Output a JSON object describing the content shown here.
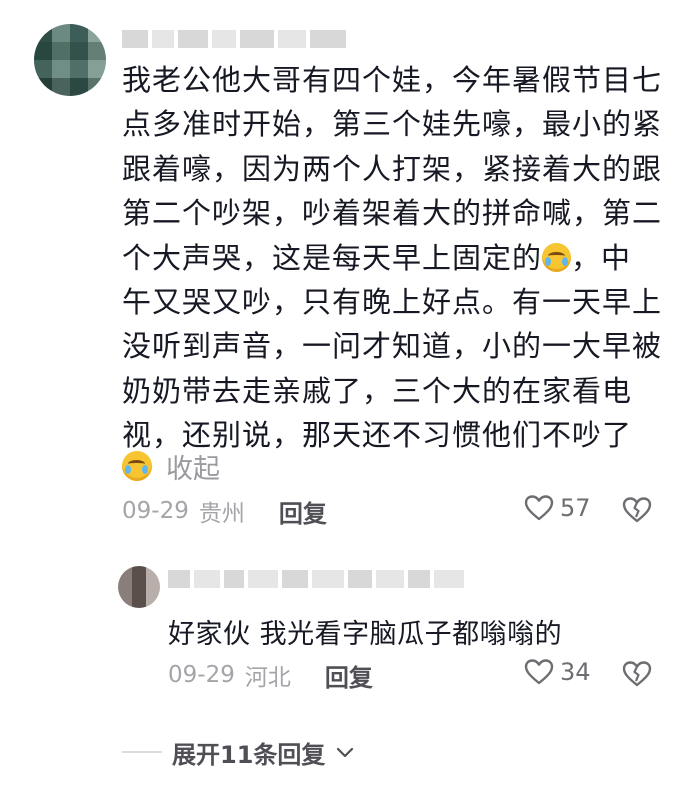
{
  "comment": {
    "lines": [
      "我老公他大哥有四个娃，今年暑假节目七",
      "点多准时开始，第三个娃先嚎，最小的紧",
      "跟着嚎，因为两个人打架，紧接着大的跟",
      "第二个吵架，吵着架着大的拼命喊，第二",
      "个大声哭，这是每天早上固定的",
      "，中",
      "午又哭又吵，只有晚上好点。有一天早上",
      "没听到声音，一问才知道，小的一大早被",
      "奶奶带去走亲戚了，三个大的在家看电",
      "视，还别说，那天还不习惯他们不吵了"
    ],
    "emoji_icon": "crying-laughing-emoji",
    "collapse_label": "收起",
    "date": "09-29",
    "location": "贵州",
    "reply_label": "回复",
    "like_count": "57"
  },
  "reply": {
    "text": "好家伙 我光看字脑瓜子都嗡嗡的",
    "date": "09-29",
    "location": "河北",
    "reply_label": "回复",
    "like_count": "34"
  },
  "expand": {
    "label": "展开11条回复"
  },
  "icons": {
    "like": "heart-outline-icon",
    "dislike": "broken-heart-outline-icon",
    "chevron": "chevron-down-icon"
  }
}
